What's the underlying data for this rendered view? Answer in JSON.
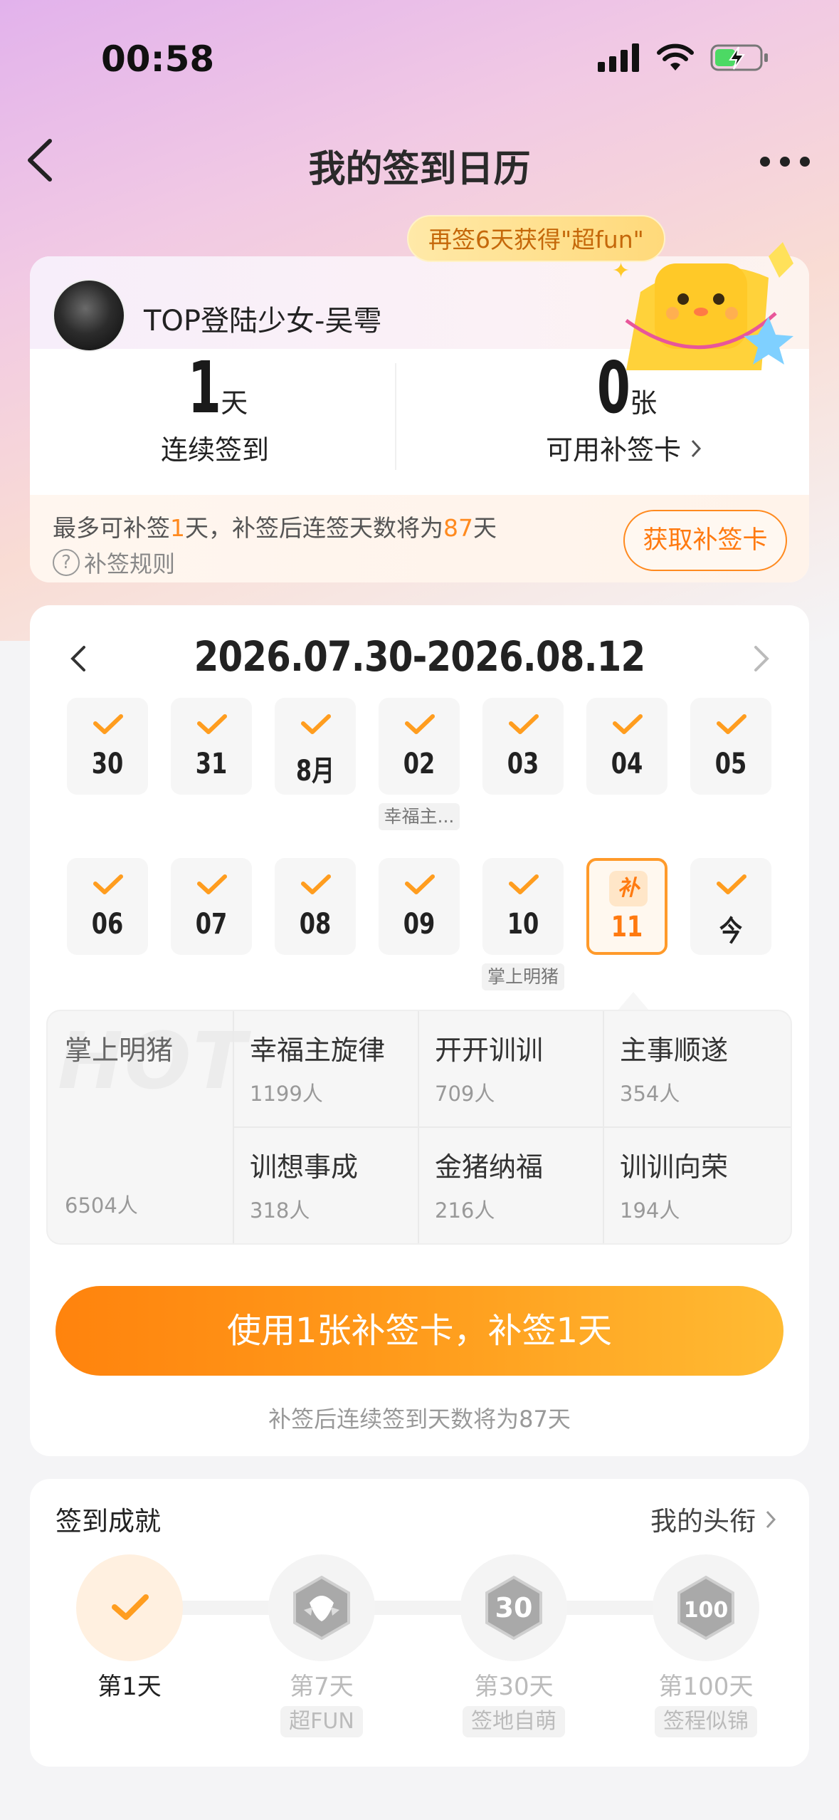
{
  "status_bar": {
    "time": "00:58"
  },
  "nav": {
    "title": "我的签到日历"
  },
  "promo": {
    "text": "再签6天获得\"超fun\""
  },
  "profile": {
    "username": "TOP登陆少女-吴雩"
  },
  "stats": {
    "streak": {
      "value": "1",
      "unit": "天",
      "label": "连续签到"
    },
    "cards": {
      "value": "0",
      "unit": "张",
      "label": "可用补签卡"
    }
  },
  "makeup_info": {
    "line_pre": "最多可补签",
    "line_num1": "1",
    "line_mid": "天，补签后连签天数将为",
    "line_num2": "87",
    "line_post": "天",
    "rules_label": "补签规则",
    "get_card_label": "获取补签卡"
  },
  "calendar": {
    "range": "2026.07.30-2026.08.12",
    "row1": [
      {
        "num": "30",
        "checked": true
      },
      {
        "num": "31",
        "checked": true
      },
      {
        "num": "8月",
        "checked": true
      },
      {
        "num": "02",
        "checked": true,
        "tag": "幸福主..."
      },
      {
        "num": "03",
        "checked": true
      },
      {
        "num": "04",
        "checked": true
      },
      {
        "num": "05",
        "checked": true
      }
    ],
    "row2": [
      {
        "num": "06",
        "checked": true
      },
      {
        "num": "07",
        "checked": true
      },
      {
        "num": "08",
        "checked": true
      },
      {
        "num": "09",
        "checked": true
      },
      {
        "num": "10",
        "checked": true,
        "tag": "掌上明猪"
      },
      {
        "num": "11",
        "checked": false,
        "makeup_badge": "补",
        "selected": true
      },
      {
        "num": "今",
        "checked": true
      }
    ]
  },
  "topics": {
    "watermark": "HOT",
    "hot": {
      "name": "掌上明猪",
      "count": "6504人"
    },
    "items": [
      {
        "name": "幸福主旋律",
        "count": "1199人"
      },
      {
        "name": "开开训训",
        "count": "709人"
      },
      {
        "name": "主事顺遂",
        "count": "354人"
      },
      {
        "name": "训想事成",
        "count": "318人"
      },
      {
        "name": "金猪纳福",
        "count": "216人"
      },
      {
        "name": "训训向荣",
        "count": "194人"
      }
    ]
  },
  "use_button": {
    "label": "使用1张补签卡，补签1天"
  },
  "use_tip": "补签后连续签到天数将为87天",
  "achievements": {
    "title": "签到成就",
    "link": "我的头衔",
    "items": [
      {
        "label": "第1天",
        "sub": "",
        "active": true
      },
      {
        "label": "第7天",
        "sub": "超FUN",
        "active": false
      },
      {
        "label": "第30天",
        "sub": "签地自萌",
        "active": false
      },
      {
        "label": "第100天",
        "sub": "签程似锦",
        "active": false
      }
    ]
  },
  "colors": {
    "accent": "#ff8a1f",
    "check": "#ff9d1f"
  }
}
